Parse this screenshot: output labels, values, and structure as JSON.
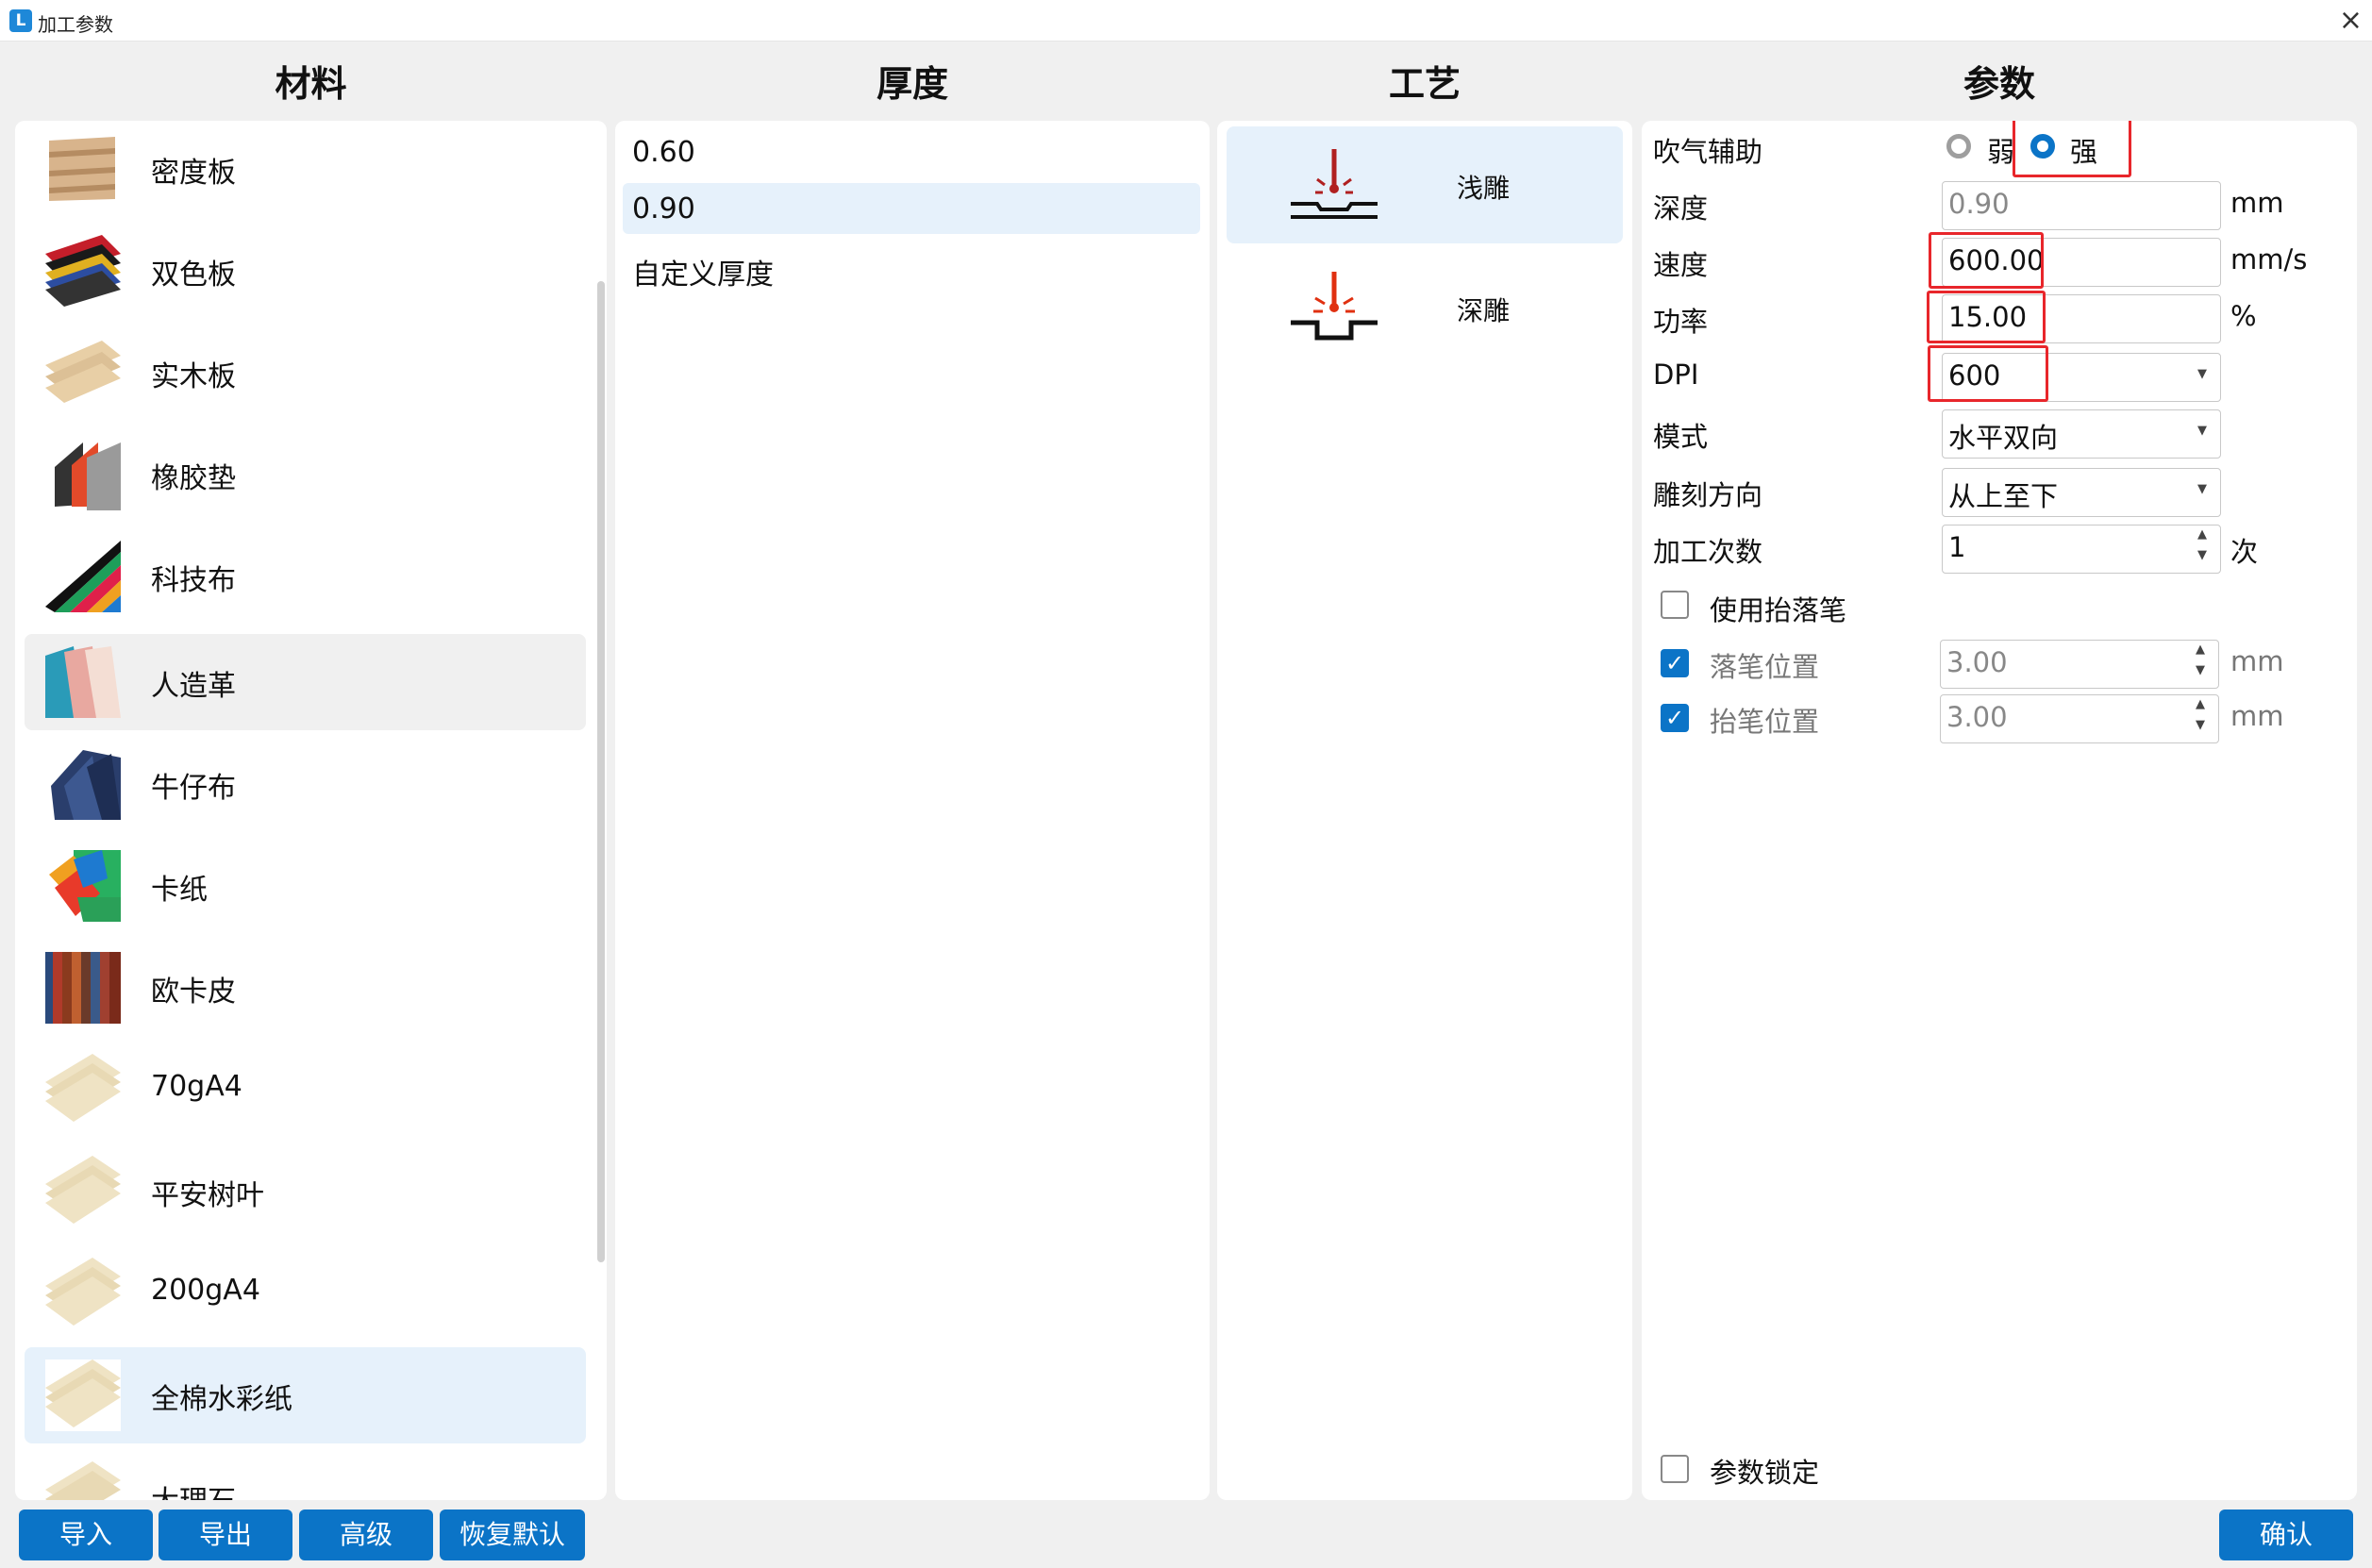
{
  "window": {
    "title": "加工参数",
    "close": "×",
    "app_icon_letter": "L"
  },
  "headers": {
    "material": "材料",
    "thickness": "厚度",
    "process": "工艺",
    "params": "参数"
  },
  "materials": [
    {
      "label": "密度板",
      "icon": "mdf-board-thumb"
    },
    {
      "label": "双色板",
      "icon": "two-color-board-thumb"
    },
    {
      "label": "实木板",
      "icon": "solid-wood-thumb"
    },
    {
      "label": "橡胶垫",
      "icon": "rubber-pad-thumb"
    },
    {
      "label": "科技布",
      "icon": "tech-cloth-thumb"
    },
    {
      "label": "人造革",
      "icon": "leatherette-thumb"
    },
    {
      "label": "牛仔布",
      "icon": "denim-thumb"
    },
    {
      "label": "卡纸",
      "icon": "cardboard-thumb"
    },
    {
      "label": "欧卡皮",
      "icon": "oka-leather-thumb"
    },
    {
      "label": "70gA4",
      "icon": "paper-thumb"
    },
    {
      "label": "平安树叶",
      "icon": "paper-thumb"
    },
    {
      "label": "200gA4",
      "icon": "paper-thumb"
    },
    {
      "label": "全棉水彩纸",
      "icon": "paper-thumb"
    },
    {
      "label": "大理石",
      "icon": "paper-thumb"
    }
  ],
  "thickness": [
    "0.60",
    "0.90",
    "自定义厚度"
  ],
  "process": [
    {
      "label": "浅雕",
      "icon": "shallow-engrave-icon"
    },
    {
      "label": "深雕",
      "icon": "deep-engrave-icon"
    }
  ],
  "params": {
    "air_assist": {
      "label": "吹气辅助",
      "weak": "弱",
      "strong": "强",
      "selected": "强"
    },
    "depth": {
      "label": "深度",
      "value": "0.90",
      "unit": "mm"
    },
    "speed": {
      "label": "速度",
      "value": "600.00",
      "unit": "mm/s"
    },
    "power": {
      "label": "功率",
      "value": "15.00",
      "unit": "%"
    },
    "dpi": {
      "label": "DPI",
      "value": "600"
    },
    "mode": {
      "label": "模式",
      "value": "水平双向"
    },
    "direction": {
      "label": "雕刻方向",
      "value": "从上至下"
    },
    "passes": {
      "label": "加工次数",
      "value": "1",
      "unit": "次"
    },
    "use_pen": {
      "label": "使用抬落笔",
      "checked": false
    },
    "pen_down": {
      "label": "落笔位置",
      "value": "3.00",
      "unit": "mm",
      "checked": true
    },
    "pen_up": {
      "label": "抬笔位置",
      "value": "3.00",
      "unit": "mm",
      "checked": true
    },
    "lock": {
      "label": "参数锁定",
      "checked": false
    }
  },
  "buttons": {
    "import": "导入",
    "export": "导出",
    "advanced": "高级",
    "reset": "恢复默认",
    "confirm": "确认"
  },
  "colors": {
    "accent": "#0b74c7",
    "selection": "#e6f1fb",
    "highlight": "#e8262b"
  }
}
